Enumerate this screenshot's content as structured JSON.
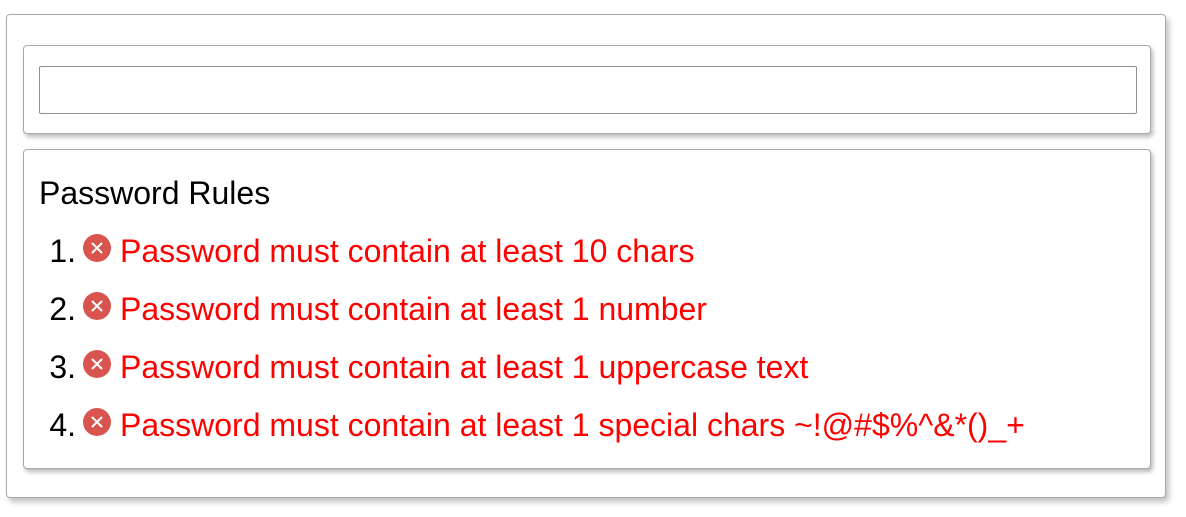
{
  "password_field": {
    "value": "",
    "placeholder": ""
  },
  "rules": {
    "title": "Password Rules",
    "items": [
      {
        "number": "1.",
        "icon": "x-circle-icon",
        "status": "failed",
        "text": "Password must contain at least 10 chars"
      },
      {
        "number": "2.",
        "icon": "x-circle-icon",
        "status": "failed",
        "text": "Password must contain at least 1 number"
      },
      {
        "number": "3.",
        "icon": "x-circle-icon",
        "status": "failed",
        "text": "Password must contain at least 1 uppercase text"
      },
      {
        "number": "4.",
        "icon": "x-circle-icon",
        "status": "failed",
        "text": "Password must contain at least 1 special chars ~!@#$%^&*()_+"
      }
    ]
  },
  "colors": {
    "fail_text": "#ff0000",
    "fail_icon": "#d9534f",
    "border": "#a9a9a9"
  }
}
